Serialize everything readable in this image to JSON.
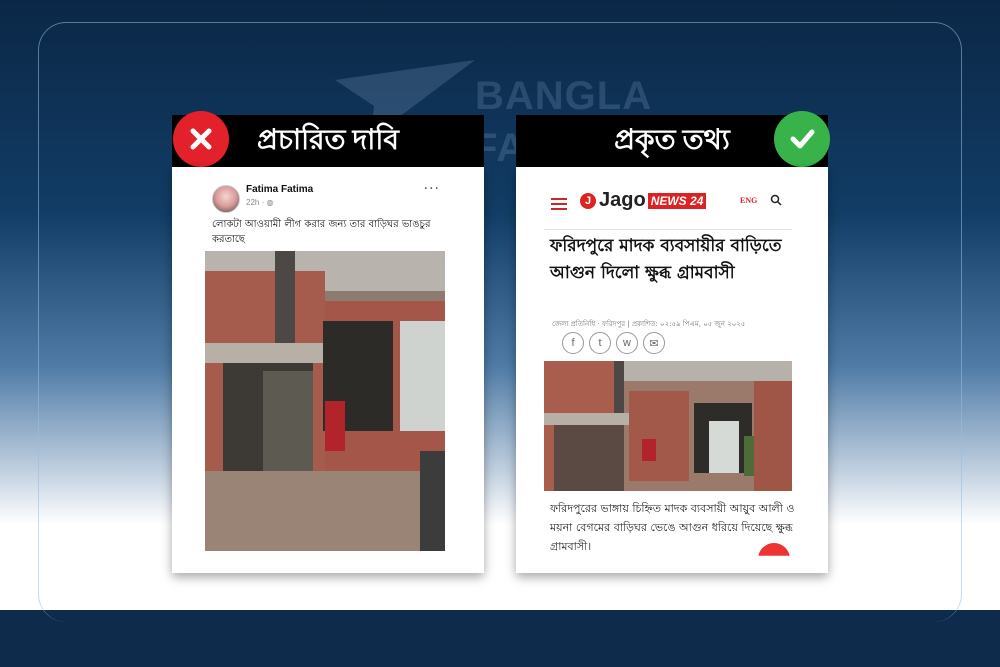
{
  "watermark": {
    "line1": "BANGLA",
    "line2": "FA"
  },
  "left_panel": {
    "header": "প্রচারিত দাবি",
    "badge_icon": "x-icon",
    "post": {
      "poster_name": "Fatima Fatima",
      "time": "22h · ",
      "more": "···",
      "caption": "লোকটা আওয়ামী লীগ করার জন্য তার বাড়িঘর ভাঙচুর করতাছে"
    }
  },
  "right_panel": {
    "header": "প্রকৃত তথ্য",
    "badge_icon": "check-icon",
    "site": {
      "logo_j": "J",
      "logo_name": "Jago",
      "logo_news": "NEWS 24",
      "lang": "ENG"
    },
    "headline": "ফরিদপুরে মাদক ব্যবসায়ীর বাড়িতে আগুন দিলো ক্ষুব্ধ গ্রামবাসী",
    "byline": "জেলা প্রতিনিধি · ফরিদপুর | প্রকাশিত: ০২:৫৯ পিএম, ০৫ জুন ২০২৫",
    "share": {
      "facebook": "f",
      "twitter": "t",
      "whatsapp": "w",
      "email": "✉"
    },
    "summary": "ফরিদপুরের ভাঙ্গায় চিহ্নিত মাদক ব্যবসায়ী আয়ুব আলী ও ময়না বেগমের বাড়িঘর ভেঙে আগুন ধরিয়ে দিয়েছে ক্ষুব্ধ গ্রামবাসী।"
  },
  "colors": {
    "red": "#e3212b",
    "green": "#37b34a",
    "brand_red": "#dd2222",
    "navy": "#0f2b4b"
  }
}
